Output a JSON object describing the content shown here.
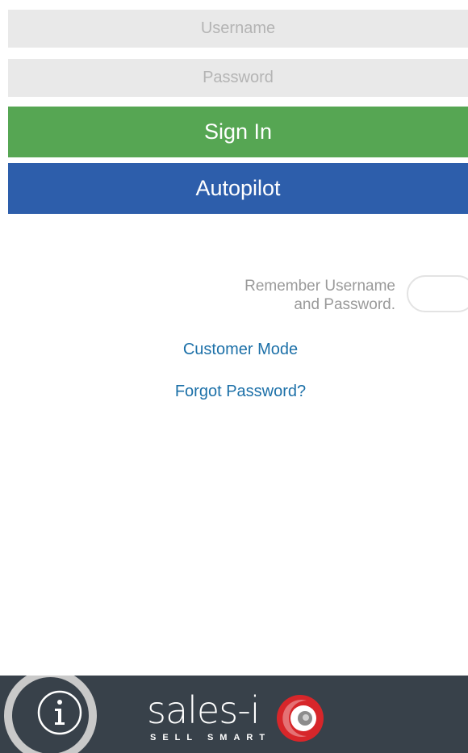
{
  "login": {
    "username_placeholder": "Username",
    "password_placeholder": "Password",
    "sign_in_label": "Sign In",
    "autopilot_label": "Autopilot",
    "remember_label_line1": "Remember Username",
    "remember_label_line2": "and Password.",
    "remember_enabled": false,
    "customer_mode_label": "Customer Mode",
    "forgot_password_label": "Forgot Password?"
  },
  "footer": {
    "info_icon": "info-icon",
    "logo_wordmark": "sales-i",
    "logo_tagline": "SELL SMART",
    "logo_mark_icon": "sales-i-logo-mark"
  },
  "colors": {
    "sign_in": "#56a653",
    "autopilot": "#2d5eab",
    "link": "#1c70a8",
    "footer_bg": "#38414a",
    "logo_red": "#d7262a",
    "field_bg": "#e9e9e9"
  }
}
